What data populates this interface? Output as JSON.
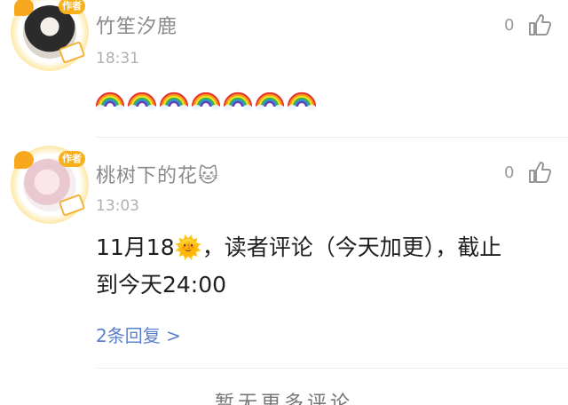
{
  "comments": [
    {
      "author_badge": "作者",
      "name": "竹笙汐鹿",
      "time": "18:31",
      "likes": "0",
      "rainbow_count": 7,
      "rainbow_icon": "rainbow-emoji"
    },
    {
      "author_badge": "作者",
      "name": "桃树下的花🐱",
      "time": "13:03",
      "likes": "0",
      "text_line1": "11月18🌞，读者评论（今天加更），截止",
      "text_line2": "到今天24:00",
      "replies": "2条回复 >"
    }
  ],
  "footer": {
    "more": "暂无更多评论"
  },
  "colors": {
    "link": "#5a7fcf",
    "badge": "#f6b11d",
    "meta": "#b0b0b0"
  }
}
